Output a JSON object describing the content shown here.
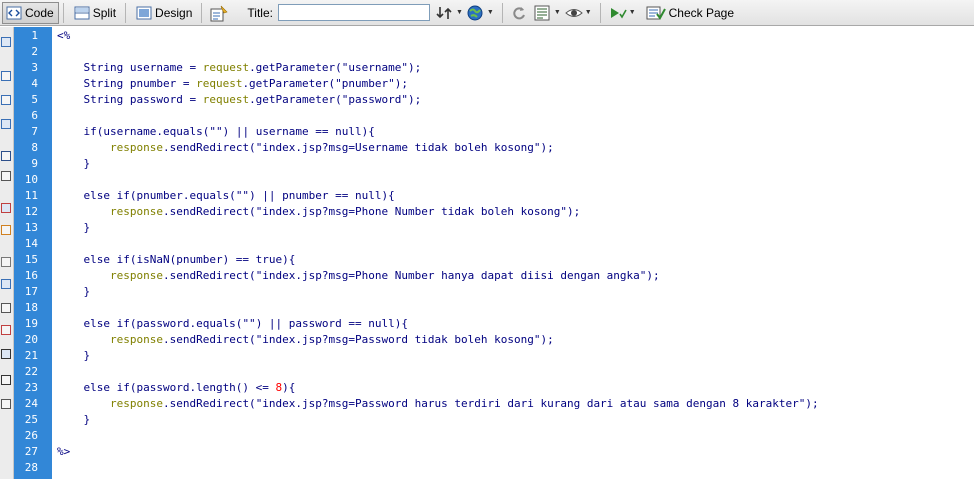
{
  "toolbar": {
    "code_label": "Code",
    "split_label": "Split",
    "design_label": "Design",
    "title_label": "Title:",
    "title_value": "",
    "check_page_label": "Check Page",
    "active_view": "code"
  },
  "editor": {
    "gutter_color": "#3287d7",
    "lines": [
      {
        "n": "1",
        "text": "<%"
      },
      {
        "n": "2",
        "text": ""
      },
      {
        "n": "3",
        "text": "    String username = request.getParameter(\"username\");"
      },
      {
        "n": "4",
        "text": "    String pnumber = request.getParameter(\"pnumber\");"
      },
      {
        "n": "5",
        "text": "    String password = request.getParameter(\"password\");"
      },
      {
        "n": "6",
        "text": ""
      },
      {
        "n": "7",
        "text": "    if(username.equals(\"\") || username == null){"
      },
      {
        "n": "8",
        "text": "        response.sendRedirect(\"index.jsp?msg=Username tidak boleh kosong\");"
      },
      {
        "n": "9",
        "text": "    }"
      },
      {
        "n": "10",
        "text": ""
      },
      {
        "n": "11",
        "text": "    else if(pnumber.equals(\"\") || pnumber == null){"
      },
      {
        "n": "12",
        "text": "        response.sendRedirect(\"index.jsp?msg=Phone Number tidak boleh kosong\");"
      },
      {
        "n": "13",
        "text": "    }"
      },
      {
        "n": "14",
        "text": ""
      },
      {
        "n": "15",
        "text": "    else if(isNaN(pnumber) == true){"
      },
      {
        "n": "16",
        "text": "        response.sendRedirect(\"index.jsp?msg=Phone Number hanya dapat diisi dengan angka\");"
      },
      {
        "n": "17",
        "text": "    }"
      },
      {
        "n": "18",
        "text": ""
      },
      {
        "n": "19",
        "text": "    else if(password.equals(\"\") || password == null){"
      },
      {
        "n": "20",
        "text": "        response.sendRedirect(\"index.jsp?msg=Password tidak boleh kosong\");"
      },
      {
        "n": "21",
        "text": "    }"
      },
      {
        "n": "22",
        "text": ""
      },
      {
        "n": "23",
        "text": "    else if(password.length() <= 8){"
      },
      {
        "n": "24",
        "text": "        response.sendRedirect(\"index.jsp?msg=Password harus terdiri dari kurang dari atau sama dengan 8 karakter\");"
      },
      {
        "n": "25",
        "text": "    }"
      },
      {
        "n": "26",
        "text": ""
      },
      {
        "n": "27",
        "text": "%>"
      },
      {
        "n": "28",
        "text": ""
      }
    ]
  },
  "sidebar": {
    "icons": [
      "collapse-full-tag-icon",
      "collapse-selection-icon",
      "expand-all-icon",
      "select-parent-tag-icon",
      "balance-braces-icon",
      "line-numbers-icon",
      "highlight-invalid-code-icon",
      "apply-comment-icon",
      "remove-comment-icon",
      "wrap-tag-icon",
      "recent-snippets-icon",
      "move-css-icon",
      "indent-code-icon",
      "outdent-code-icon",
      "format-source-code-icon"
    ]
  }
}
